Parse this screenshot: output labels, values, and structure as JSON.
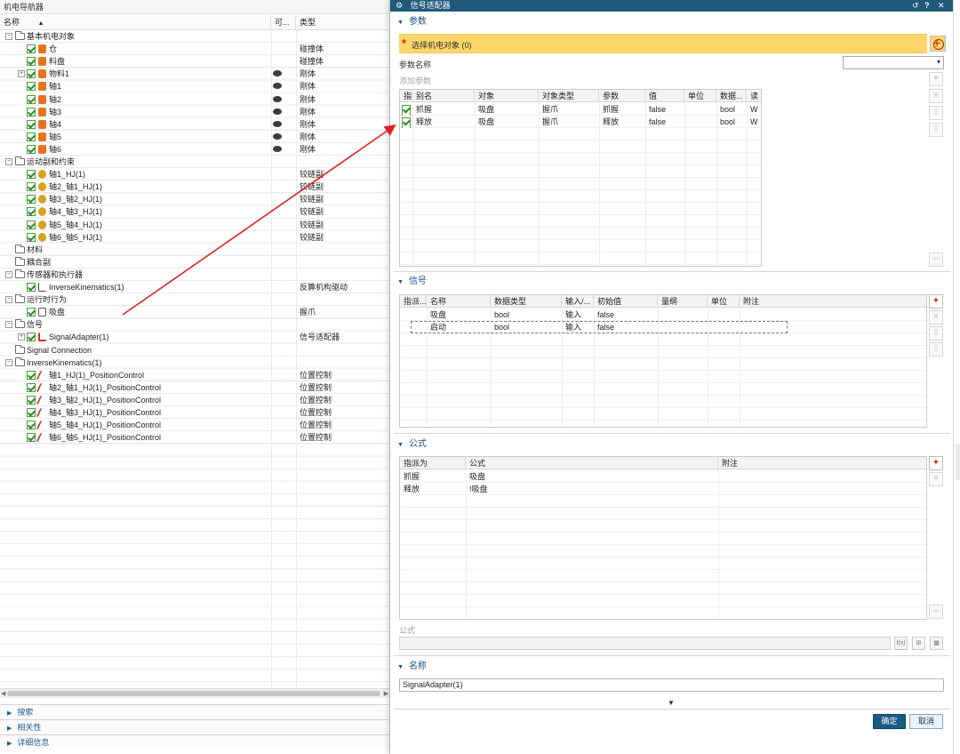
{
  "navigator": {
    "title": "机电导航器",
    "columns": {
      "name": "名称",
      "visible": "可...",
      "type": "类型"
    },
    "rows": [
      {
        "level": 0,
        "kind": "folder",
        "expand": "−",
        "label": "基本机电对象",
        "type": "",
        "eye": false,
        "check": false
      },
      {
        "level": 1,
        "kind": "body",
        "label": "仓",
        "type": "碰撞体",
        "eye": false,
        "check": true
      },
      {
        "level": 1,
        "kind": "body",
        "label": "料盘",
        "type": "碰撞体",
        "eye": false,
        "check": true
      },
      {
        "level": 1,
        "kind": "body",
        "expand": "+",
        "label": "物料1",
        "type": "刚体",
        "eye": true,
        "check": true
      },
      {
        "level": 1,
        "kind": "body",
        "label": "轴1",
        "type": "刚体",
        "eye": true,
        "check": true
      },
      {
        "level": 1,
        "kind": "body",
        "label": "轴2",
        "type": "刚体",
        "eye": true,
        "check": true
      },
      {
        "level": 1,
        "kind": "body",
        "label": "轴3",
        "type": "刚体",
        "eye": true,
        "check": true
      },
      {
        "level": 1,
        "kind": "body",
        "label": "轴4",
        "type": "刚体",
        "eye": true,
        "check": true
      },
      {
        "level": 1,
        "kind": "body",
        "label": "轴5",
        "type": "刚体",
        "eye": true,
        "check": true
      },
      {
        "level": 1,
        "kind": "body",
        "label": "轴6",
        "type": "刚体",
        "eye": true,
        "check": true
      },
      {
        "level": 0,
        "kind": "folder",
        "expand": "−",
        "label": "运动副和约束",
        "type": "",
        "eye": false,
        "check": false
      },
      {
        "level": 1,
        "kind": "joint",
        "label": "轴1_HJ(1)",
        "type": "铰链副",
        "eye": false,
        "check": true
      },
      {
        "level": 1,
        "kind": "joint",
        "label": "轴2_轴1_HJ(1)",
        "type": "铰链副",
        "eye": false,
        "check": true
      },
      {
        "level": 1,
        "kind": "joint",
        "label": "轴3_轴2_HJ(1)",
        "type": "铰链副",
        "eye": false,
        "check": true
      },
      {
        "level": 1,
        "kind": "joint",
        "label": "轴4_轴3_HJ(1)",
        "type": "铰链副",
        "eye": false,
        "check": true
      },
      {
        "level": 1,
        "kind": "joint",
        "label": "轴5_轴4_HJ(1)",
        "type": "铰链副",
        "eye": false,
        "check": true
      },
      {
        "level": 1,
        "kind": "joint",
        "label": "轴6_轴5_HJ(1)",
        "type": "铰链副",
        "eye": false,
        "check": true
      },
      {
        "level": 0,
        "kind": "folder",
        "label": "材料",
        "type": "",
        "eye": false,
        "check": false
      },
      {
        "level": 0,
        "kind": "folder",
        "label": "耦合副",
        "type": "",
        "eye": false,
        "check": false
      },
      {
        "level": 0,
        "kind": "folder",
        "expand": "−",
        "label": "传感器和执行器",
        "type": "",
        "eye": false,
        "check": false
      },
      {
        "level": 1,
        "kind": "ik",
        "label": "InverseKinematics(1)",
        "type": "反算机构驱动",
        "eye": false,
        "check": true
      },
      {
        "level": 0,
        "kind": "folder",
        "expand": "−",
        "label": "运行时行为",
        "type": "",
        "eye": false,
        "check": false
      },
      {
        "level": 1,
        "kind": "grip",
        "label": "吸盘",
        "type": "握爪",
        "eye": false,
        "check": true
      },
      {
        "level": 0,
        "kind": "folder",
        "expand": "−",
        "label": "信号",
        "type": "",
        "eye": false,
        "check": false
      },
      {
        "level": 1,
        "kind": "sig",
        "expand": "+",
        "label": "SignalAdapter(1)",
        "type": "信号适配器",
        "eye": false,
        "check": true
      },
      {
        "level": 0,
        "kind": "folder",
        "label": "Signal Connection",
        "type": "",
        "eye": false,
        "check": false
      },
      {
        "level": 0,
        "kind": "folder",
        "expand": "−",
        "label": "InverseKinematics(1)",
        "type": "",
        "eye": false,
        "check": false
      },
      {
        "level": 1,
        "kind": "pos",
        "label": "轴1_HJ(1)_PositionControl",
        "type": "位置控制",
        "eye": false,
        "check": true
      },
      {
        "level": 1,
        "kind": "pos",
        "label": "轴2_轴1_HJ(1)_PositionControl",
        "type": "位置控制",
        "eye": false,
        "check": true
      },
      {
        "level": 1,
        "kind": "pos",
        "label": "轴3_轴2_HJ(1)_PositionControl",
        "type": "位置控制",
        "eye": false,
        "check": true
      },
      {
        "level": 1,
        "kind": "pos",
        "label": "轴4_轴3_HJ(1)_PositionControl",
        "type": "位置控制",
        "eye": false,
        "check": true
      },
      {
        "level": 1,
        "kind": "pos",
        "label": "轴5_轴4_HJ(1)_PositionControl",
        "type": "位置控制",
        "eye": false,
        "check": true
      },
      {
        "level": 1,
        "kind": "pos",
        "label": "轴6_轴5_HJ(1)_PositionControl",
        "type": "位置控制",
        "eye": false,
        "check": true
      }
    ],
    "sections": [
      "搜索",
      "相关性",
      "详细信息"
    ]
  },
  "dialog": {
    "title": "信号适配器",
    "parameters": {
      "header": "参数",
      "select_object": "选择机电对象 (0)",
      "param_name_label": "参数名称",
      "add_param_label": "添加参数",
      "columns": [
        "指",
        "别名",
        "对象",
        "对象类型",
        "参数",
        "值",
        "单位",
        "数据...",
        "读"
      ],
      "rows": [
        [
          "",
          "抓握",
          "吸盘",
          "握爪",
          "抓握",
          "false",
          "",
          "bool",
          "W"
        ],
        [
          "",
          "释放",
          "吸盘",
          "握爪",
          "释放",
          "false",
          "",
          "bool",
          "W"
        ]
      ]
    },
    "signals": {
      "header": "信号",
      "columns": [
        "指派...",
        "名称",
        "数据类型",
        "输入/...",
        "初始值",
        "量纲",
        "单位",
        "附注"
      ],
      "rows": [
        [
          "",
          "吸盘",
          "bool",
          "输入",
          "false",
          "",
          "",
          ""
        ],
        [
          "",
          "启动",
          "bool",
          "输入",
          "false",
          "",
          "",
          ""
        ]
      ]
    },
    "formulas": {
      "header": "公式",
      "columns": [
        "指派为",
        "公式",
        "附注"
      ],
      "rows": [
        [
          "抓握",
          "吸盘",
          ""
        ],
        [
          "释放",
          "!吸盘",
          ""
        ]
      ],
      "formula_label": "公式",
      "fx_label": "f(x)"
    },
    "name_group": {
      "header": "名称",
      "value": "SignalAdapter(1)"
    },
    "ok_label": "确定",
    "cancel_label": "取消"
  },
  "colors": {
    "title_bar": "#1f5a7a",
    "select_highlight": "#fcd66a",
    "annotation_arrow": "#e02020",
    "check_green": "#2e8b25"
  }
}
